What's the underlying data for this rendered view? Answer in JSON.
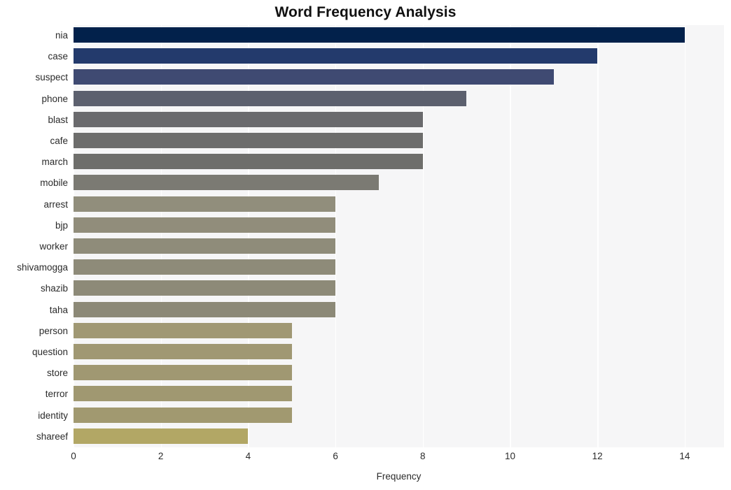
{
  "chart_data": {
    "type": "bar",
    "orientation": "horizontal",
    "title": "Word Frequency Analysis",
    "xlabel": "Frequency",
    "ylabel": "",
    "xlim": [
      0,
      14.9
    ],
    "ylim": [
      0,
      20
    ],
    "grid": "vertical-only",
    "legend": "none",
    "xticks": [
      0,
      2,
      4,
      6,
      8,
      10,
      12,
      14
    ],
    "categories": [
      "nia",
      "case",
      "suspect",
      "phone",
      "blast",
      "cafe",
      "march",
      "mobile",
      "arrest",
      "bjp",
      "worker",
      "shivamogga",
      "shazib",
      "taha",
      "person",
      "question",
      "store",
      "terror",
      "identity",
      "shareef"
    ],
    "values": [
      14,
      12,
      11,
      9,
      8,
      8,
      8,
      7,
      6,
      6,
      6,
      6,
      6,
      6,
      5,
      5,
      5,
      5,
      5,
      4
    ],
    "bar_colors": [
      "#02214b",
      "#233a6c",
      "#3f4a72",
      "#5c606e",
      "#6a6a6d",
      "#6d6d6c",
      "#6e6e6b",
      "#7b7a73",
      "#918e7c",
      "#918d7b",
      "#8f8c7a",
      "#8e8b79",
      "#8d8a78",
      "#8c8977",
      "#a09874",
      "#a09873",
      "#a09872",
      "#a09871",
      "#a19970",
      "#b2a765"
    ],
    "plot_background": "#f6f6f7",
    "gridline_color": "#ffffff",
    "figure_background": "#ffffff",
    "text_color": "#2b2b2b"
  }
}
